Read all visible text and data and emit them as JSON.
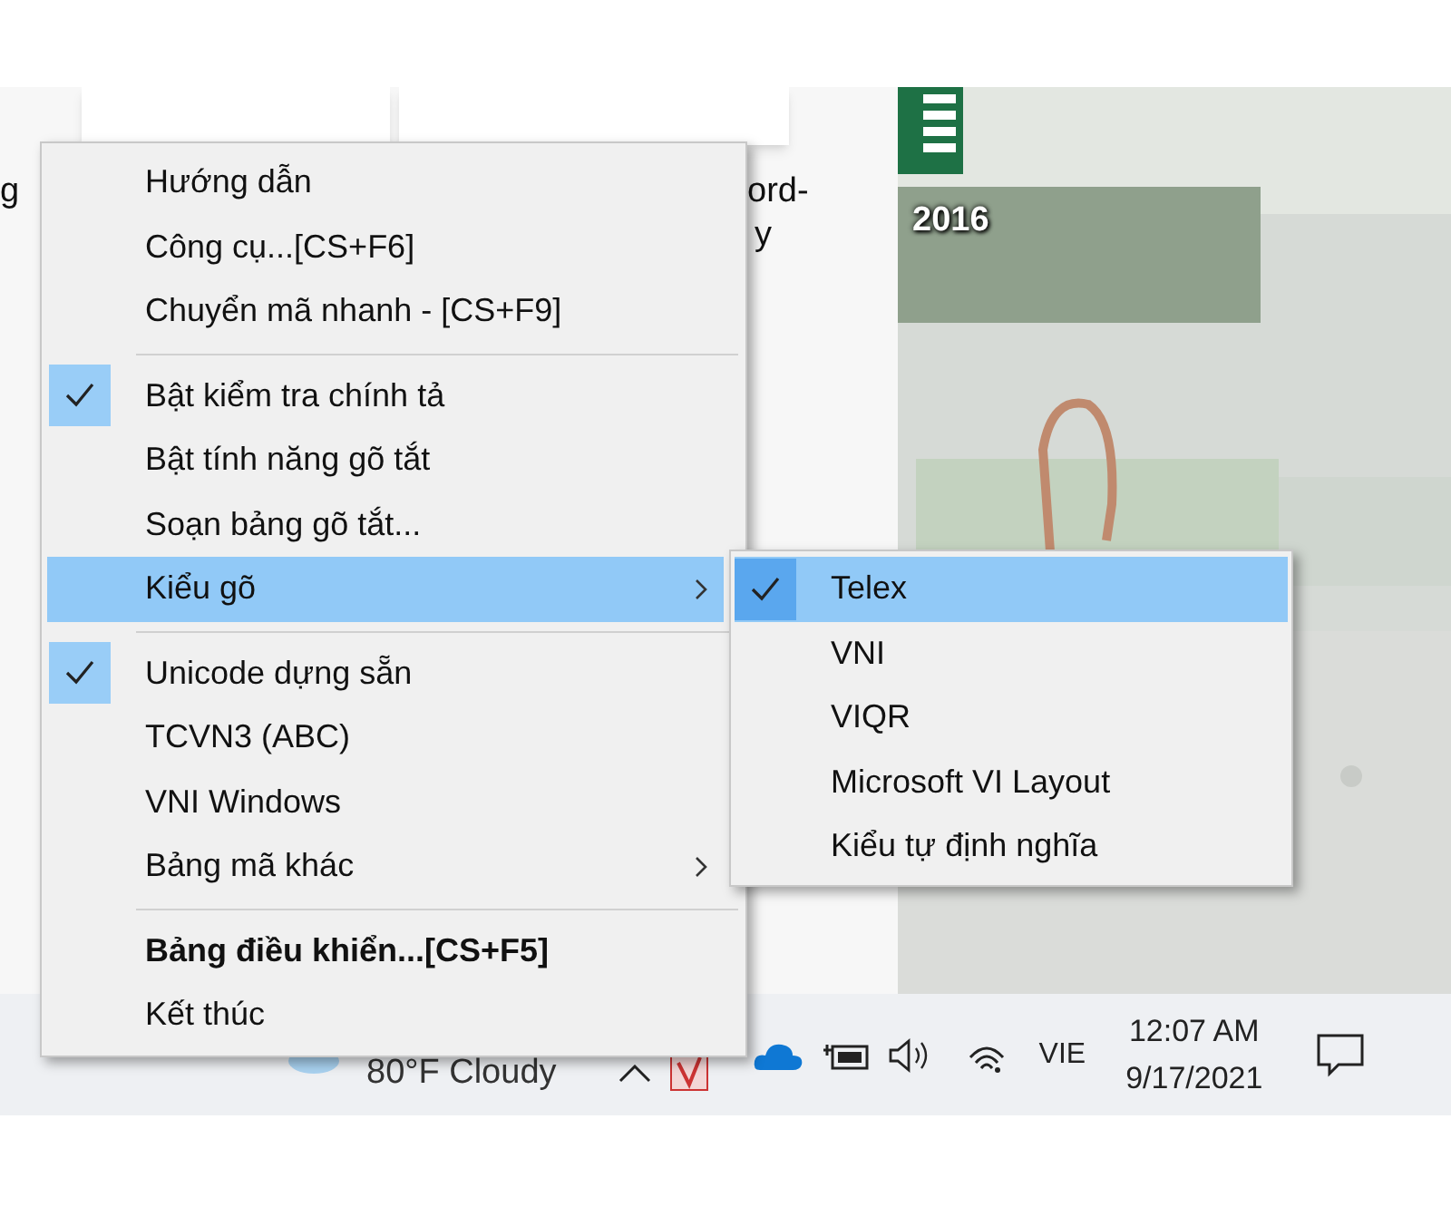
{
  "desktop": {
    "icon_labels": [
      {
        "text": "g"
      },
      {
        "text": "ord-"
      },
      {
        "text": "y"
      },
      {
        "text": "2016"
      }
    ]
  },
  "context_menu": {
    "items": [
      {
        "kind": "item",
        "label": "Hướng dẫn",
        "checked": false,
        "selected": false,
        "bold": false,
        "submenu": false
      },
      {
        "kind": "item",
        "label": "Công cụ...[CS+F6]",
        "checked": false,
        "selected": false,
        "bold": false,
        "submenu": false
      },
      {
        "kind": "item",
        "label": "Chuyển mã nhanh - [CS+F9]",
        "checked": false,
        "selected": false,
        "bold": false,
        "submenu": false
      },
      {
        "kind": "separator"
      },
      {
        "kind": "item",
        "label": "Bật kiểm tra chính tả",
        "checked": true,
        "selected": false,
        "bold": false,
        "submenu": false
      },
      {
        "kind": "item",
        "label": "Bật tính năng gõ tắt",
        "checked": false,
        "selected": false,
        "bold": false,
        "submenu": false
      },
      {
        "kind": "item",
        "label": "Soạn bảng gõ tắt...",
        "checked": false,
        "selected": false,
        "bold": false,
        "submenu": false
      },
      {
        "kind": "item",
        "label": "Kiểu gõ",
        "checked": false,
        "selected": true,
        "bold": false,
        "submenu": true
      },
      {
        "kind": "separator"
      },
      {
        "kind": "item",
        "label": "Unicode dựng sẵn",
        "checked": true,
        "selected": false,
        "bold": false,
        "submenu": false
      },
      {
        "kind": "item",
        "label": "TCVN3 (ABC)",
        "checked": false,
        "selected": false,
        "bold": false,
        "submenu": false
      },
      {
        "kind": "item",
        "label": "VNI Windows",
        "checked": false,
        "selected": false,
        "bold": false,
        "submenu": false
      },
      {
        "kind": "item",
        "label": "Bảng mã khác",
        "checked": false,
        "selected": false,
        "bold": false,
        "submenu": true
      },
      {
        "kind": "separator"
      },
      {
        "kind": "item",
        "label": "Bảng điều khiển...[CS+F5]",
        "checked": false,
        "selected": false,
        "bold": true,
        "submenu": false
      },
      {
        "kind": "item",
        "label": "Kết thúc",
        "checked": false,
        "selected": false,
        "bold": false,
        "submenu": false
      }
    ]
  },
  "submenu": {
    "items": [
      {
        "label": "Telex",
        "checked": true,
        "selected": true
      },
      {
        "label": "VNI",
        "checked": false,
        "selected": false
      },
      {
        "label": "VIQR",
        "checked": false,
        "selected": false
      },
      {
        "label": "Microsoft VI Layout",
        "checked": false,
        "selected": false
      },
      {
        "label": "Kiểu tự định nghĩa",
        "checked": false,
        "selected": false
      }
    ]
  },
  "taskbar": {
    "weather": "80°F Cloudy",
    "language": "VIE",
    "time": "12:07 AM",
    "date": "9/17/2021"
  }
}
